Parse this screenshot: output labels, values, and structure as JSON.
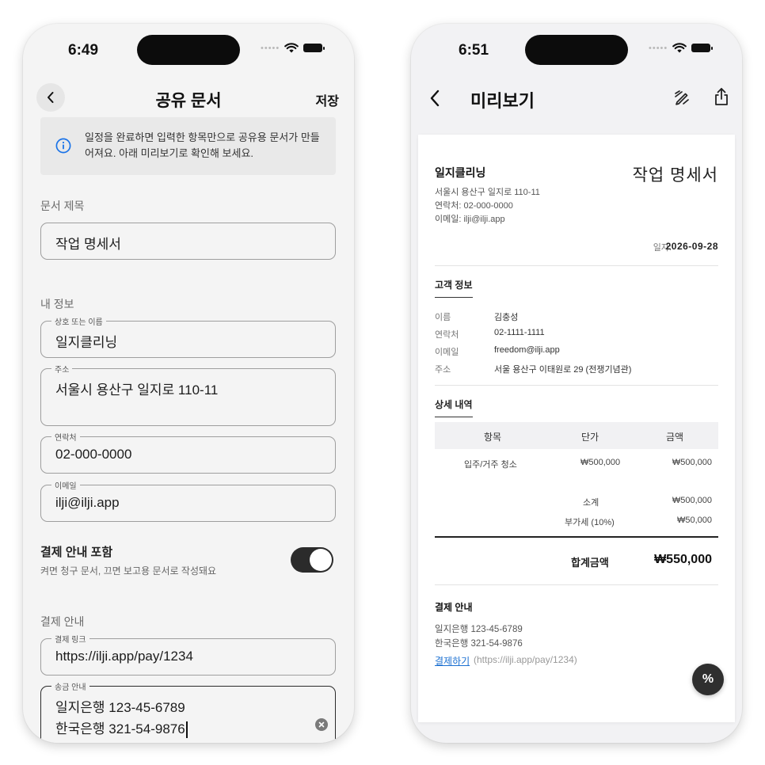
{
  "left": {
    "status_time": "6:49",
    "nav_title": "공유 문서",
    "save_label": "저장",
    "info_text": "일정을 완료하면 입력한 항목만으로 공유용 문서가 만들어져요. 아래 미리보기로 확인해 보세요.",
    "doc_title_label": "문서 제목",
    "doc_title_value": "작업 명세서",
    "my_info_label": "내 정보",
    "name_legend": "상호 또는 이름",
    "name_value": "일지클리닝",
    "address_legend": "주소",
    "address_value": "서울시 용산구 일지로 110-11",
    "phone_legend": "연락처",
    "phone_value": "02-000-0000",
    "email_legend": "이메일",
    "email_value": "ilji@ilji.app",
    "payment_toggle_title": "결제 안내 포함",
    "payment_toggle_sub": "켜면 청구 문서, 끄면 보고용 문서로 작성돼요",
    "payment_toggle_on": true,
    "payment_section_label": "결제 안내",
    "pay_link_legend": "결제 링크",
    "pay_link_value": "https://ilji.app/pay/1234",
    "transfer_legend": "송금 안내",
    "transfer_line1": "일지은행 123-45-6789",
    "transfer_line2": "한국은행 321-54-9876"
  },
  "right": {
    "status_time": "6:51",
    "nav_title": "미리보기",
    "doc": {
      "company": "일지클리닝",
      "title": "작업 명세서",
      "address": "서울시 용산구 일지로 110-11",
      "phone": "연락처: 02-000-0000",
      "email": "이메일: ilji@ilji.app",
      "date_label": "일자:",
      "date_value": "2026-09-28",
      "customer_head": "고객 정보",
      "customer": [
        {
          "k": "이름",
          "v": "김충성"
        },
        {
          "k": "연락처",
          "v": "02-1111-1111"
        },
        {
          "k": "이메일",
          "v": "freedom@ilji.app"
        },
        {
          "k": "주소",
          "v": "서울 용산구 이태원로 29 (전쟁기념관)"
        }
      ],
      "detail_head": "상세 내역",
      "columns": [
        "항목",
        "단가",
        "금액"
      ],
      "rows": [
        {
          "item": "입주/거주 청소",
          "price": "₩500,000",
          "amount": "₩500,000"
        }
      ],
      "subtotal_label": "소계",
      "subtotal_value": "₩500,000",
      "vat_label": "부가세 (10%)",
      "vat_value": "₩50,000",
      "total_label": "합계금액",
      "total_value": "₩550,000",
      "payment_head": "결제 안내",
      "bank1": "일지은행 123-45-6789",
      "bank2": "한국은행 321-54-9876",
      "pay_link_text": "결제하기",
      "pay_link_url": "(https://ilji.app/pay/1234)"
    },
    "fab_label": "%"
  }
}
